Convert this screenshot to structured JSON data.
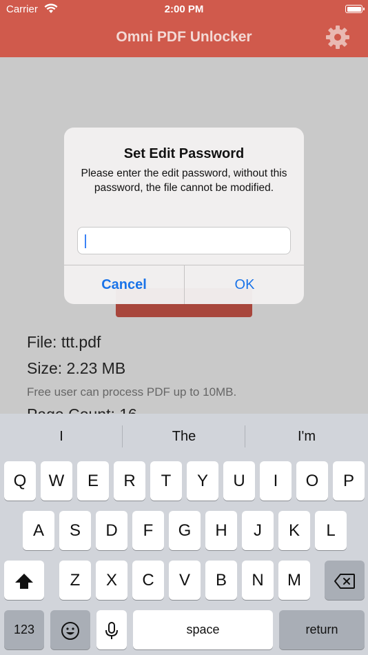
{
  "status_bar": {
    "carrier": "Carrier",
    "time": "2:00 PM"
  },
  "nav": {
    "title": "Omni PDF Unlocker",
    "settings_icon": "gear-icon"
  },
  "file_info": {
    "file": "File: ttt.pdf",
    "size": "Size: 2.23 MB",
    "note": "Free user can process PDF up to 10MB.",
    "page_count": "Page Count: 16"
  },
  "dialog": {
    "title": "Set Edit Password",
    "message": "Please enter the edit password, without this password, the file cannot be modified.",
    "input_value": "",
    "cancel_label": "Cancel",
    "ok_label": "OK"
  },
  "keyboard": {
    "suggestions": [
      "I",
      "The",
      "I'm"
    ],
    "row1": [
      "Q",
      "W",
      "E",
      "R",
      "T",
      "Y",
      "U",
      "I",
      "O",
      "P"
    ],
    "row2": [
      "A",
      "S",
      "D",
      "F",
      "G",
      "H",
      "J",
      "K",
      "L"
    ],
    "row3": [
      "Z",
      "X",
      "C",
      "V",
      "B",
      "N",
      "M"
    ],
    "numbers_label": "123",
    "space_label": "space",
    "return_label": "return"
  },
  "colors": {
    "brand": "#d05a4c",
    "accent": "#1a73e8"
  }
}
